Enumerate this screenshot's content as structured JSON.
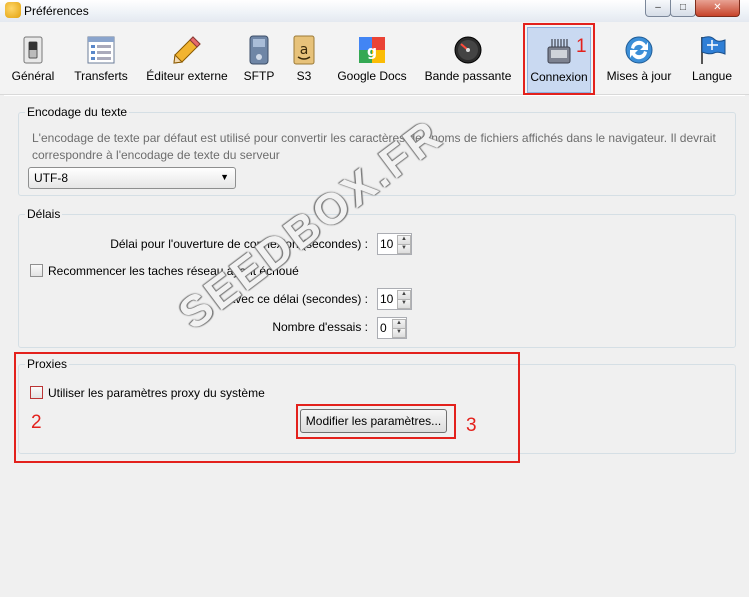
{
  "window": {
    "title": "Préférences",
    "minimize": "–",
    "maximize": "□",
    "close": "✕"
  },
  "toolbar": {
    "items": [
      {
        "label": "Général",
        "icon": "switch-icon"
      },
      {
        "label": "Transferts",
        "icon": "transfer-list-icon"
      },
      {
        "label": "Éditeur externe",
        "icon": "pencil-icon"
      },
      {
        "label": "SFTP",
        "icon": "drive-icon"
      },
      {
        "label": "S3",
        "icon": "amazon-s3-icon"
      },
      {
        "label": "Google Docs",
        "icon": "google-docs-icon"
      },
      {
        "label": "Bande passante",
        "icon": "gauge-icon"
      },
      {
        "label": "Connexion",
        "icon": "network-connector-icon"
      },
      {
        "label": "Mises à jour",
        "icon": "update-icon"
      },
      {
        "label": "Langue",
        "icon": "flag-icon"
      }
    ],
    "active": "Connexion"
  },
  "encoding": {
    "group_label": "Encodage du texte",
    "description": "L'encodage de texte par défaut est utilisé pour convertir les caractères des noms de fichiers affichés dans le navigateur. Il devrait correspondre à l'encodage de texte du serveur",
    "selected": "UTF-8"
  },
  "delays": {
    "group_label": "Délais",
    "connection_timeout_label": "Délai pour l'ouverture de connexion (secondes) :",
    "connection_timeout_value": "10",
    "retry_label": "Recommencer les taches réseau ayant échoué",
    "retry_delay_label": "avec ce délai (secondes) :",
    "retry_delay_value": "10",
    "attempts_label": "Nombre d'essais :",
    "attempts_value": "0"
  },
  "proxies": {
    "group_label": "Proxies",
    "system_proxy_label": "Utiliser les paramètres proxy du système",
    "modify_button": "Modifier les paramètres..."
  },
  "annotations": {
    "n1": "1",
    "n2": "2",
    "n3": "3",
    "color": "#e3211c"
  },
  "watermark": "SEEDBOX.FR"
}
